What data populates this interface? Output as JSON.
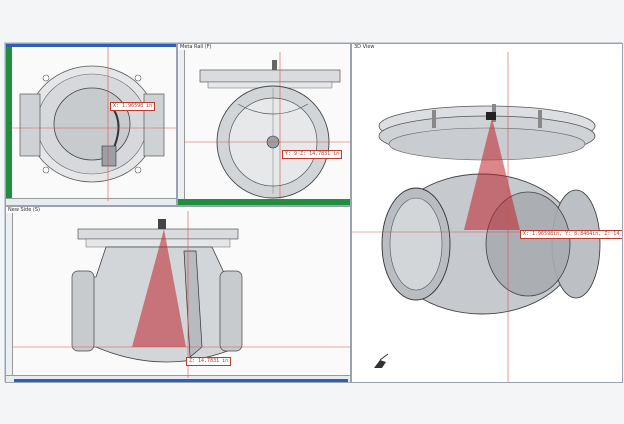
{
  "panes": {
    "top": {
      "title": "",
      "readout": "X: 1.96598 in"
    },
    "front": {
      "title": "Meta Rail (F)",
      "readout": "Y: 9  Z: 14.7831 in"
    },
    "side": {
      "title": "New Side (S)",
      "readout": "Z: 14.7831 in"
    },
    "view3d": {
      "title": "3D View",
      "readout": "X: 1.96598in, Y: 8.8404in, Z: 14.7831in"
    }
  },
  "colors": {
    "ruler_green": "#1f8f3f",
    "ruler_blue": "#2f5db8",
    "crosshair": "#d9534f",
    "laser": "#c0202a"
  },
  "icons": [
    "axis-triad-icon"
  ]
}
